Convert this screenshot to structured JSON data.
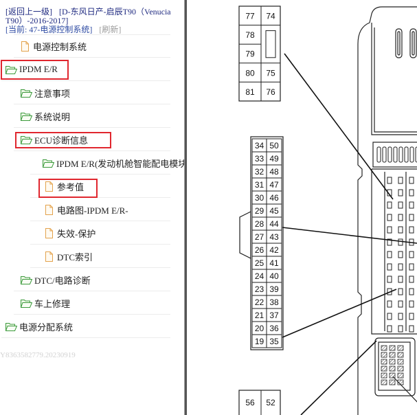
{
  "header": {
    "back_link": "[返回上一级]",
    "vehicle_link": "[D-东风日产-启辰T90（Venucia T90）-2016-2017]",
    "current": "[当前: 47-电源控制系统]",
    "refresh": "[刷新]"
  },
  "tree": {
    "items": [
      {
        "label": "电源控制系统",
        "icon": "document-icon"
      },
      {
        "label": "IPDM E/R",
        "icon": "folder-open-icon"
      },
      {
        "label": "注意事项",
        "icon": "folder-open-icon"
      },
      {
        "label": "系统说明",
        "icon": "folder-open-icon"
      },
      {
        "label": "ECU诊断信息",
        "icon": "folder-open-icon"
      },
      {
        "label": "IPDM E/R(发动机舱智能配电模块",
        "icon": "folder-open-icon"
      },
      {
        "label": "参考值",
        "icon": "document-icon"
      },
      {
        "label": "电路图-IPDM E/R-",
        "icon": "document-icon"
      },
      {
        "label": "失效-保护",
        "icon": "document-icon"
      },
      {
        "label": "DTC索引",
        "icon": "document-icon"
      },
      {
        "label": "DTC/电路诊断",
        "icon": "folder-open-icon"
      },
      {
        "label": "车上修理",
        "icon": "folder-open-icon"
      },
      {
        "label": "电源分配系统",
        "icon": "folder-open-icon"
      }
    ]
  },
  "watermark": "Y8363582779.20230919",
  "diagram": {
    "connector_top": [
      {
        "left": "77",
        "right": "74"
      },
      {
        "left": "78"
      },
      {
        "left": "79"
      },
      {
        "left": "80",
        "right": "75"
      },
      {
        "left": "81",
        "right": "76"
      }
    ],
    "connector_middle": [
      [
        "34",
        "50"
      ],
      [
        "33",
        "49"
      ],
      [
        "32",
        "48"
      ],
      [
        "31",
        "47"
      ],
      [
        "30",
        "46"
      ],
      [
        "29",
        "45"
      ],
      [
        "28",
        "44"
      ],
      [
        "27",
        "43"
      ],
      [
        "26",
        "42"
      ],
      [
        "25",
        "41"
      ],
      [
        "24",
        "40"
      ],
      [
        "23",
        "39"
      ],
      [
        "22",
        "38"
      ],
      [
        "21",
        "37"
      ],
      [
        "20",
        "36"
      ],
      [
        "19",
        "35"
      ]
    ],
    "connector_bottom": [
      {
        "left": "56",
        "right": "52"
      }
    ]
  },
  "colors": {
    "link": "#1f2a80",
    "current": "#2e4ba3",
    "muted": "#9b9b9b",
    "highlight": "#e0262e",
    "folder": "#3c9a3c",
    "document": "#e3a24c",
    "watermark": "#d2d2d2"
  }
}
